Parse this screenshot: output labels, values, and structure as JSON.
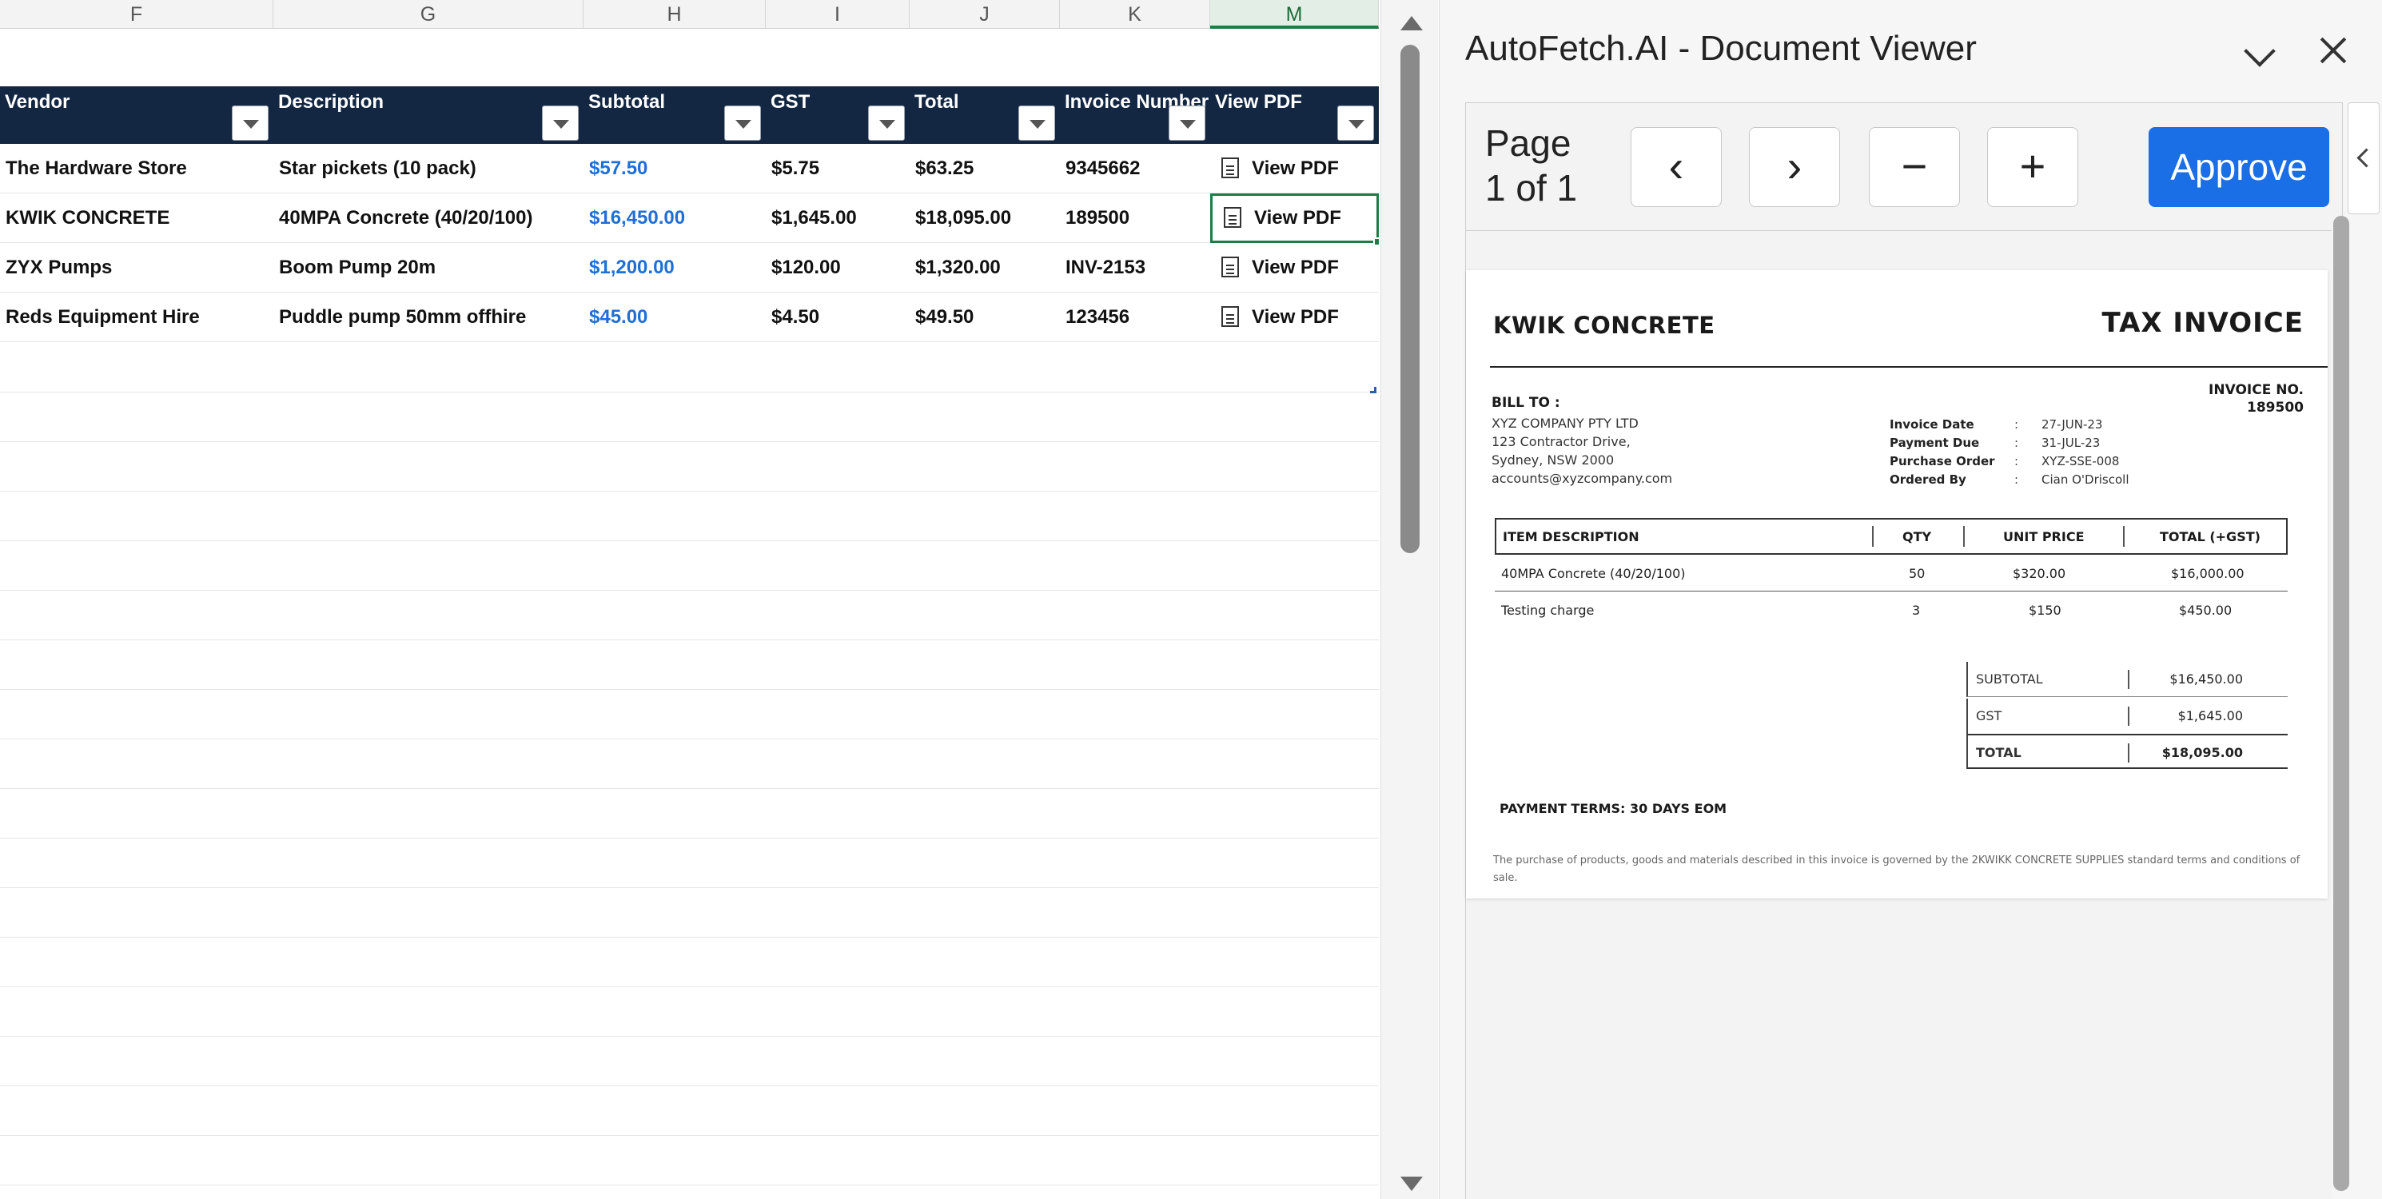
{
  "sheet": {
    "columns": [
      {
        "letter": "F",
        "active": false
      },
      {
        "letter": "G",
        "active": false
      },
      {
        "letter": "H",
        "active": false
      },
      {
        "letter": "I",
        "active": false
      },
      {
        "letter": "J",
        "active": false
      },
      {
        "letter": "K",
        "active": false
      },
      {
        "letter": "M",
        "active": true
      }
    ],
    "headers": [
      "Vendor",
      "Description",
      "Subtotal",
      "GST",
      "Total",
      "Invoice Number",
      "View PDF"
    ],
    "rows": [
      {
        "vendor": "The Hardware Store",
        "description": "Star pickets (10 pack)",
        "subtotal": "$57.50",
        "gst": "$5.75",
        "total": "$63.25",
        "invoice_number": "9345662",
        "pdf": "View PDF"
      },
      {
        "vendor": "KWIK CONCRETE",
        "description": "40MPA Concrete (40/20/100)",
        "subtotal": "$16,450.00",
        "gst": "$1,645.00",
        "total": "$18,095.00",
        "invoice_number": "189500",
        "pdf": "View PDF"
      },
      {
        "vendor": "ZYX Pumps",
        "description": "Boom Pump 20m",
        "subtotal": "$1,200.00",
        "gst": "$120.00",
        "total": "$1,320.00",
        "invoice_number": "INV-2153",
        "pdf": "View PDF"
      },
      {
        "vendor": "Reds Equipment Hire",
        "description": "Puddle pump 50mm offhire",
        "subtotal": "$45.00",
        "gst": "$4.50",
        "total": "$49.50",
        "invoice_number": "123456",
        "pdf": "View PDF"
      }
    ],
    "selected_row": 1,
    "colors": {
      "header_bg": "#132642",
      "link_blue": "#1f6fd6",
      "selection": "#1e7d46"
    }
  },
  "viewer": {
    "title": "AutoFetch.AI - Document Viewer",
    "page_label": "Page\n1 of 1",
    "page_line1": "Page",
    "page_line2": "1 of 1",
    "prev_label": "‹",
    "next_label": "›",
    "zoom_out_label": "−",
    "zoom_in_label": "+",
    "approve_label": "Approve",
    "colors": {
      "approve": "#1a6ee6"
    }
  },
  "invoice": {
    "vendor": "KWIK CONCRETE",
    "title": "TAX INVOICE",
    "invoice_no_label": "INVOICE NO.",
    "invoice_no": "189500",
    "bill_to_label": "BILL TO :",
    "bill_to": [
      "XYZ COMPANY PTY LTD",
      "123 Contractor Drive,",
      "Sydney, NSW 2000",
      "accounts@xyzcompany.com"
    ],
    "meta": [
      {
        "label": "Invoice Date",
        "value": "27-JUN-23"
      },
      {
        "label": "Payment Due",
        "value": "31-JUL-23"
      },
      {
        "label": "Purchase Order",
        "value": "XYZ-SSE-008"
      },
      {
        "label": "Ordered By",
        "value": "Cian O'Driscoll"
      }
    ],
    "items_header": {
      "description": "ITEM DESCRIPTION",
      "qty": "QTY",
      "unit_price": "UNIT PRICE",
      "total": "TOTAL (+GST)"
    },
    "items": [
      {
        "description": "40MPA Concrete (40/20/100)",
        "qty": "50",
        "unit_price": "$320.00",
        "total": "$16,000.00"
      },
      {
        "description": "Testing charge",
        "qty": "3",
        "unit_price": "$150",
        "total": "$450.00"
      }
    ],
    "totals": [
      {
        "label": "SUBTOTAL",
        "value": "$16,450.00"
      },
      {
        "label": "GST",
        "value": "$1,645.00"
      },
      {
        "label": "TOTAL",
        "value": "$18,095.00"
      }
    ],
    "payment_terms": "PAYMENT TERMS: 30 DAYS EOM",
    "footer": "The purchase of products, goods and materials described in this invoice is governed by the 2KWIKK CONCRETE SUPPLIES standard terms and conditions of sale."
  }
}
